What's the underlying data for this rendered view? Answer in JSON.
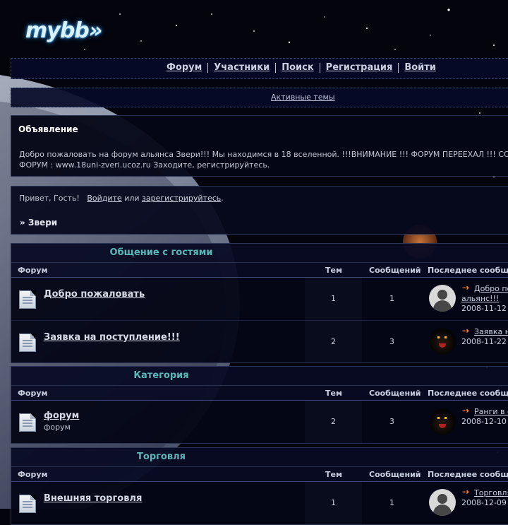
{
  "logo": {
    "text": "mybb»"
  },
  "nav": {
    "items": [
      "Форум",
      "Участники",
      "Поиск",
      "Регистрация",
      "Войти"
    ]
  },
  "active_topics": "Активные темы",
  "announcement": {
    "title": "Объявление",
    "text_line1": "Добро пожаловать на форум альянса Звери!!! Мы находимся в 18 вселенной. !!!ВНИМАНИЕ !!! ФОРУМ ПЕРЕЕХАЛ !!! СС",
    "text_line2": "ФОРУМ : www.18uni-zveri.ucoz.ru Заходите, регистрируйтесь."
  },
  "guest": {
    "greeting": "Привет, Гость!",
    "login": "Войдите",
    "or": "или",
    "register": "зарегистрируйтесь",
    "period": ".",
    "breadcrumb": "» Звери"
  },
  "columns": {
    "forum": "Форум",
    "topics": "Тем",
    "posts": "Сообщений",
    "last": "Последнее сообщен"
  },
  "categories": [
    {
      "title": "Общение с гостями",
      "rows": [
        {
          "name": "Добро пожаловать",
          "desc": "",
          "topics": "1",
          "posts": "1",
          "avatar": "grey-user-avatar",
          "last_title": "Добро по",
          "last_title2": "альянс!!!",
          "last_date": "2008-11-12"
        },
        {
          "name": "Заявка на поступление!!!",
          "desc": "",
          "topics": "2",
          "posts": "3",
          "avatar": "wolf-avatar",
          "last_title": "Заявка н",
          "last_title2": "",
          "last_date": "2008-11-22"
        }
      ]
    },
    {
      "title": "Категория",
      "rows": [
        {
          "name": "форум",
          "desc": "форум",
          "topics": "2",
          "posts": "3",
          "avatar": "wolf-avatar",
          "last_title": "Ранги в с",
          "last_title2": "",
          "last_date": "2008-12-10"
        }
      ]
    },
    {
      "title": "Торговля",
      "rows": [
        {
          "name": "Внешняя торговля",
          "desc": "",
          "topics": "1",
          "posts": "1",
          "avatar": "grey-user-avatar",
          "last_title": "Торговля",
          "last_title2": "",
          "last_date": "2008-12-09"
        }
      ]
    }
  ],
  "colors": {
    "accent_teal": "#5ab7b7",
    "arrow_orange": "#ff7a2a",
    "panel_border": "#2a3556"
  }
}
